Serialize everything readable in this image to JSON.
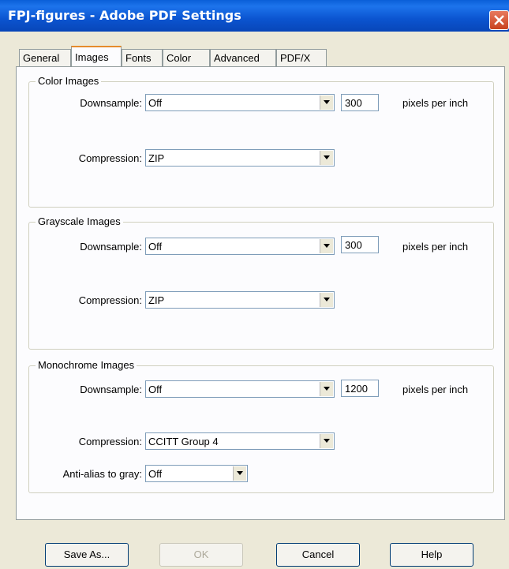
{
  "window": {
    "title": "FPJ-figures - Adobe PDF Settings"
  },
  "tabs": [
    "General",
    "Images",
    "Fonts",
    "Color",
    "Advanced",
    "PDF/X"
  ],
  "active_tab": "Images",
  "groups": {
    "color": {
      "title": "Color Images",
      "downsample_label": "Downsample:",
      "downsample_value": "Off",
      "resolution": "300",
      "unit": "pixels per inch",
      "compression_label": "Compression:",
      "compression_value": "ZIP"
    },
    "grayscale": {
      "title": "Grayscale Images",
      "downsample_label": "Downsample:",
      "downsample_value": "Off",
      "resolution": "300",
      "unit": "pixels per inch",
      "compression_label": "Compression:",
      "compression_value": "ZIP"
    },
    "monochrome": {
      "title": "Monochrome Images",
      "downsample_label": "Downsample:",
      "downsample_value": "Off",
      "resolution": "1200",
      "unit": "pixels per inch",
      "compression_label": "Compression:",
      "compression_value": "CCITT Group 4",
      "antialias_label": "Anti-alias to gray:",
      "antialias_value": "Off"
    }
  },
  "buttons": {
    "save_as": "Save As...",
    "ok": "OK",
    "cancel": "Cancel",
    "help": "Help"
  },
  "icons": {
    "close": "close-x-icon",
    "dropdown": "dropdown-arrow-icon"
  },
  "colors": {
    "titlebar": "#0a5fd8",
    "close_button": "#d8542e",
    "dialog_bg": "#ece9d8",
    "active_tab_accent": "#e68b2c"
  }
}
